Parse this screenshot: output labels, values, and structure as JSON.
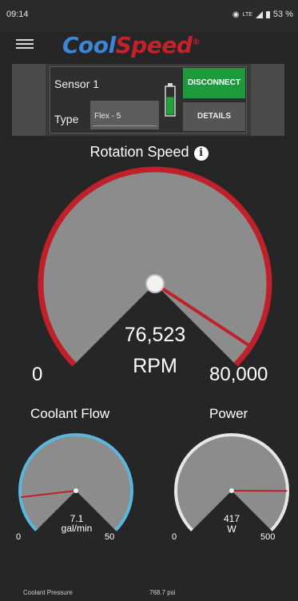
{
  "status_bar": {
    "time": "09:14",
    "network_label": "LTE",
    "battery_percent": "53 %"
  },
  "app": {
    "logo_part1": "Cool",
    "logo_part2": "Speed",
    "logo_mark": "®",
    "brand_color": "#3b86d6",
    "accent_color": "#c8202a"
  },
  "sensor": {
    "name": "Sensor 1",
    "type_label": "Type",
    "type_value": "Flex - 5",
    "disconnect_label": "DISCONNECT",
    "details_label": "DETAILS",
    "battery_level": 0.62
  },
  "rotation_speed": {
    "title": "Rotation Speed",
    "value_text": "76,523",
    "unit": "RPM",
    "min_label": "0",
    "max_label": "80,000",
    "min": 0,
    "max": 80000,
    "value": 76523
  },
  "coolant_flow": {
    "title": "Coolant Flow",
    "value_text": "7.1",
    "unit": "gal/min",
    "min_label": "0",
    "max_label": "50",
    "min": 0,
    "max": 50,
    "value": 7.1
  },
  "power": {
    "title": "Power",
    "value_text": "417",
    "unit": "W",
    "min_label": "0",
    "max_label": "500",
    "min": 0,
    "max": 500,
    "value": 417
  },
  "footer": {
    "label": "Coolant Pressure",
    "value": "768.7 psi"
  }
}
